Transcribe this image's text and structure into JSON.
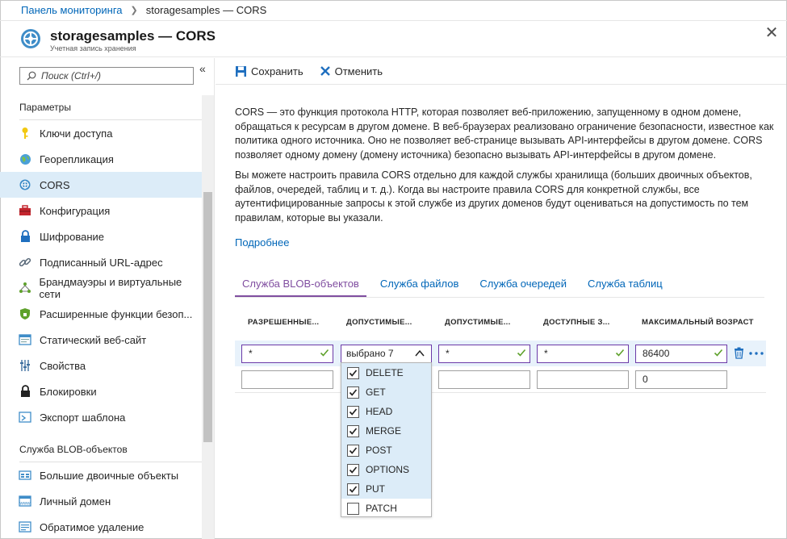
{
  "breadcrumb": {
    "parent": "Панель мониторинга",
    "current": "storagesamples — CORS"
  },
  "header": {
    "title": "storagesamples — CORS",
    "subtitle": "Учетная запись хранения"
  },
  "sidebar": {
    "search_placeholder": "Поиск (Ctrl+/)",
    "collapse_glyph": "«",
    "section_settings": "Параметры",
    "settings_items": [
      {
        "label": "Ключи доступа",
        "icon": "key-icon"
      },
      {
        "label": "Георепликация",
        "icon": "globe-icon"
      },
      {
        "label": "CORS",
        "icon": "cors-icon",
        "active": true
      },
      {
        "label": "Конфигурация",
        "icon": "toolbox-icon"
      },
      {
        "label": "Шифрование",
        "icon": "lock-icon"
      },
      {
        "label": "Подписанный URL-адрес",
        "icon": "link-icon"
      },
      {
        "label": "Брандмауэры и виртуальные сети",
        "icon": "network-icon"
      },
      {
        "label": "Расширенные функции безоп...",
        "icon": "shield-icon"
      },
      {
        "label": "Статический веб-сайт",
        "icon": "website-icon"
      },
      {
        "label": "Свойства",
        "icon": "properties-icon"
      },
      {
        "label": "Блокировки",
        "icon": "padlock-icon"
      },
      {
        "label": "Экспорт шаблона",
        "icon": "export-icon"
      }
    ],
    "section_blob": "Служба BLOB-объектов",
    "blob_items": [
      {
        "label": "Большие двоичные объекты",
        "icon": "blob-icon"
      },
      {
        "label": "Личный домен",
        "icon": "domain-icon"
      },
      {
        "label": "Обратимое удаление",
        "icon": "soft-delete-icon"
      }
    ]
  },
  "toolbar": {
    "save_label": "Сохранить",
    "cancel_label": "Отменить"
  },
  "description": {
    "p1": "CORS — это функция протокола HTTP, которая позволяет веб-приложению, запущенному в одном домене, обращаться к ресурсам в другом домене. В веб-браузерах реализовано ограничение безопасности, известное как политика одного источника. Оно не позволяет веб-странице  вызывать API-интерфейсы в другом домене. CORS позволяет одному домену (домену источника) безопасно вызывать API-интерфейсы в другом домене.",
    "p2": "Вы можете настроить правила CORS отдельно для каждой службы хранилища (больших двоичных объектов, файлов, очередей, таблиц и т. д.). Когда вы настроите правила CORS для конкретной службы, все аутентифицированные запросы к этой службе из других доменов будут оцениваться на допустимость по тем правилам, которые вы указали.",
    "learn_more": "Подробнее"
  },
  "tabs": [
    {
      "label": "Служба BLOB-объектов",
      "active": true
    },
    {
      "label": "Служба файлов"
    },
    {
      "label": "Служба очередей"
    },
    {
      "label": "Служба таблиц"
    }
  ],
  "table": {
    "headers": [
      "РАЗРЕШЕННЫЕ...",
      "ДОПУСТИМЫЕ...",
      "ДОПУСТИМЫЕ...",
      "ДОСТУПНЫЕ З...",
      "МАКСИМАЛЬНЫЙ ВОЗРАСТ"
    ],
    "row1": {
      "origins": "*",
      "methods": "выбрано 7",
      "headers": "*",
      "exposed": "*",
      "max_age": "86400"
    },
    "row2": {
      "origins": "",
      "headers": "",
      "exposed": "",
      "max_age": "0"
    }
  },
  "methods_dropdown": [
    {
      "label": "DELETE",
      "checked": true
    },
    {
      "label": "GET",
      "checked": true
    },
    {
      "label": "HEAD",
      "checked": true
    },
    {
      "label": "MERGE",
      "checked": true
    },
    {
      "label": "POST",
      "checked": true
    },
    {
      "label": "OPTIONS",
      "checked": true
    },
    {
      "label": "PUT",
      "checked": true
    },
    {
      "label": "PATCH",
      "checked": false
    }
  ],
  "colors": {
    "link": "#0066b8",
    "active_tab": "#804ea0",
    "valid_border": "#6b3aa8",
    "check_green": "#5ea12b",
    "selected_bg": "#dcecf8"
  }
}
